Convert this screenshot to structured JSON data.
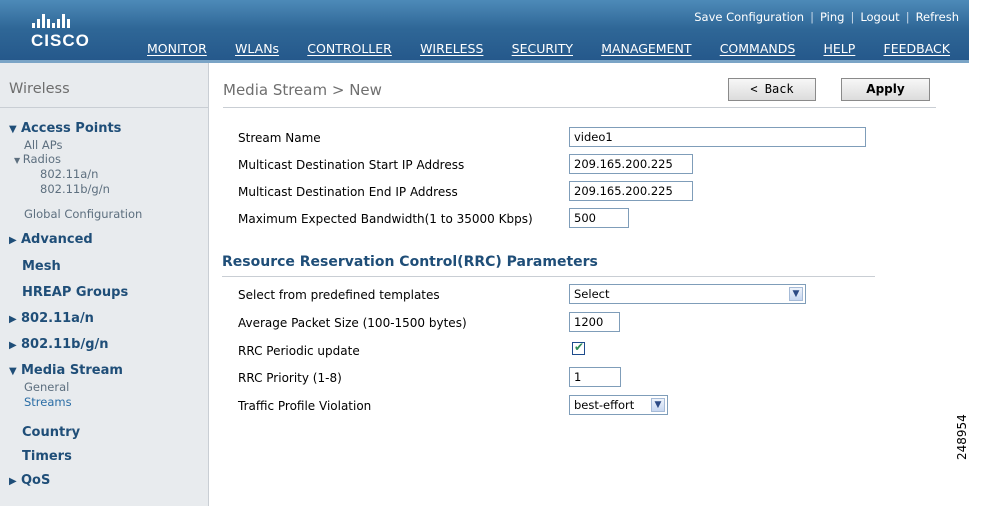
{
  "header": {
    "logo_text": "CISCO",
    "utility_links": [
      "Save Configuration",
      "Ping",
      "Logout",
      "Refresh"
    ],
    "main_nav": [
      "MONITOR",
      "WLANs",
      "CONTROLLER",
      "WIRELESS",
      "SECURITY",
      "MANAGEMENT",
      "COMMANDS",
      "HELP",
      "FEEDBACK"
    ],
    "active_nav": "WIRELESS"
  },
  "sidebar": {
    "title": "Wireless",
    "items": {
      "access_points": "Access Points",
      "all_aps": "All APs",
      "radios": "Radios",
      "radio_a": "802.11a/n",
      "radio_bg": "802.11b/g/n",
      "global_config": "Global Configuration",
      "advanced": "Advanced",
      "mesh": "Mesh",
      "hreap": "HREAP Groups",
      "dot11an": "802.11a/n",
      "dot11bgn": "802.11b/g/n",
      "media_stream": "Media Stream",
      "general": "General",
      "streams": "Streams",
      "country": "Country",
      "timers": "Timers",
      "qos": "QoS"
    }
  },
  "main": {
    "title": "Media Stream > New",
    "back_label": "< Back",
    "apply_label": "Apply",
    "fields": {
      "stream_name_label": "Stream Name",
      "stream_name_value": "video1",
      "start_ip_label": "Multicast Destination Start IP Address",
      "start_ip_value": "209.165.200.225",
      "end_ip_label": "Multicast Destination End IP Address",
      "end_ip_value": "209.165.200.225",
      "bandwidth_label": "Maximum Expected Bandwidth(1 to 35000 Kbps)",
      "bandwidth_value": "500"
    },
    "rrc": {
      "heading": "Resource Reservation Control(RRC) Parameters",
      "template_label": "Select from predefined templates",
      "template_value": "Select",
      "packet_size_label": "Average Packet Size (100-1500 bytes)",
      "packet_size_value": "1200",
      "periodic_label": "RRC Periodic update",
      "periodic_checked": true,
      "priority_label": "RRC Priority (1-8)",
      "priority_value": "1",
      "violation_label": "Traffic Profile Violation",
      "violation_value": "best-effort"
    }
  },
  "figure_id": "248954",
  "colors": {
    "header": "#2f6797",
    "active_tab": "#f7941d",
    "nav_text": "#1f4e78",
    "sidebar_bg": "#e8ebee"
  }
}
